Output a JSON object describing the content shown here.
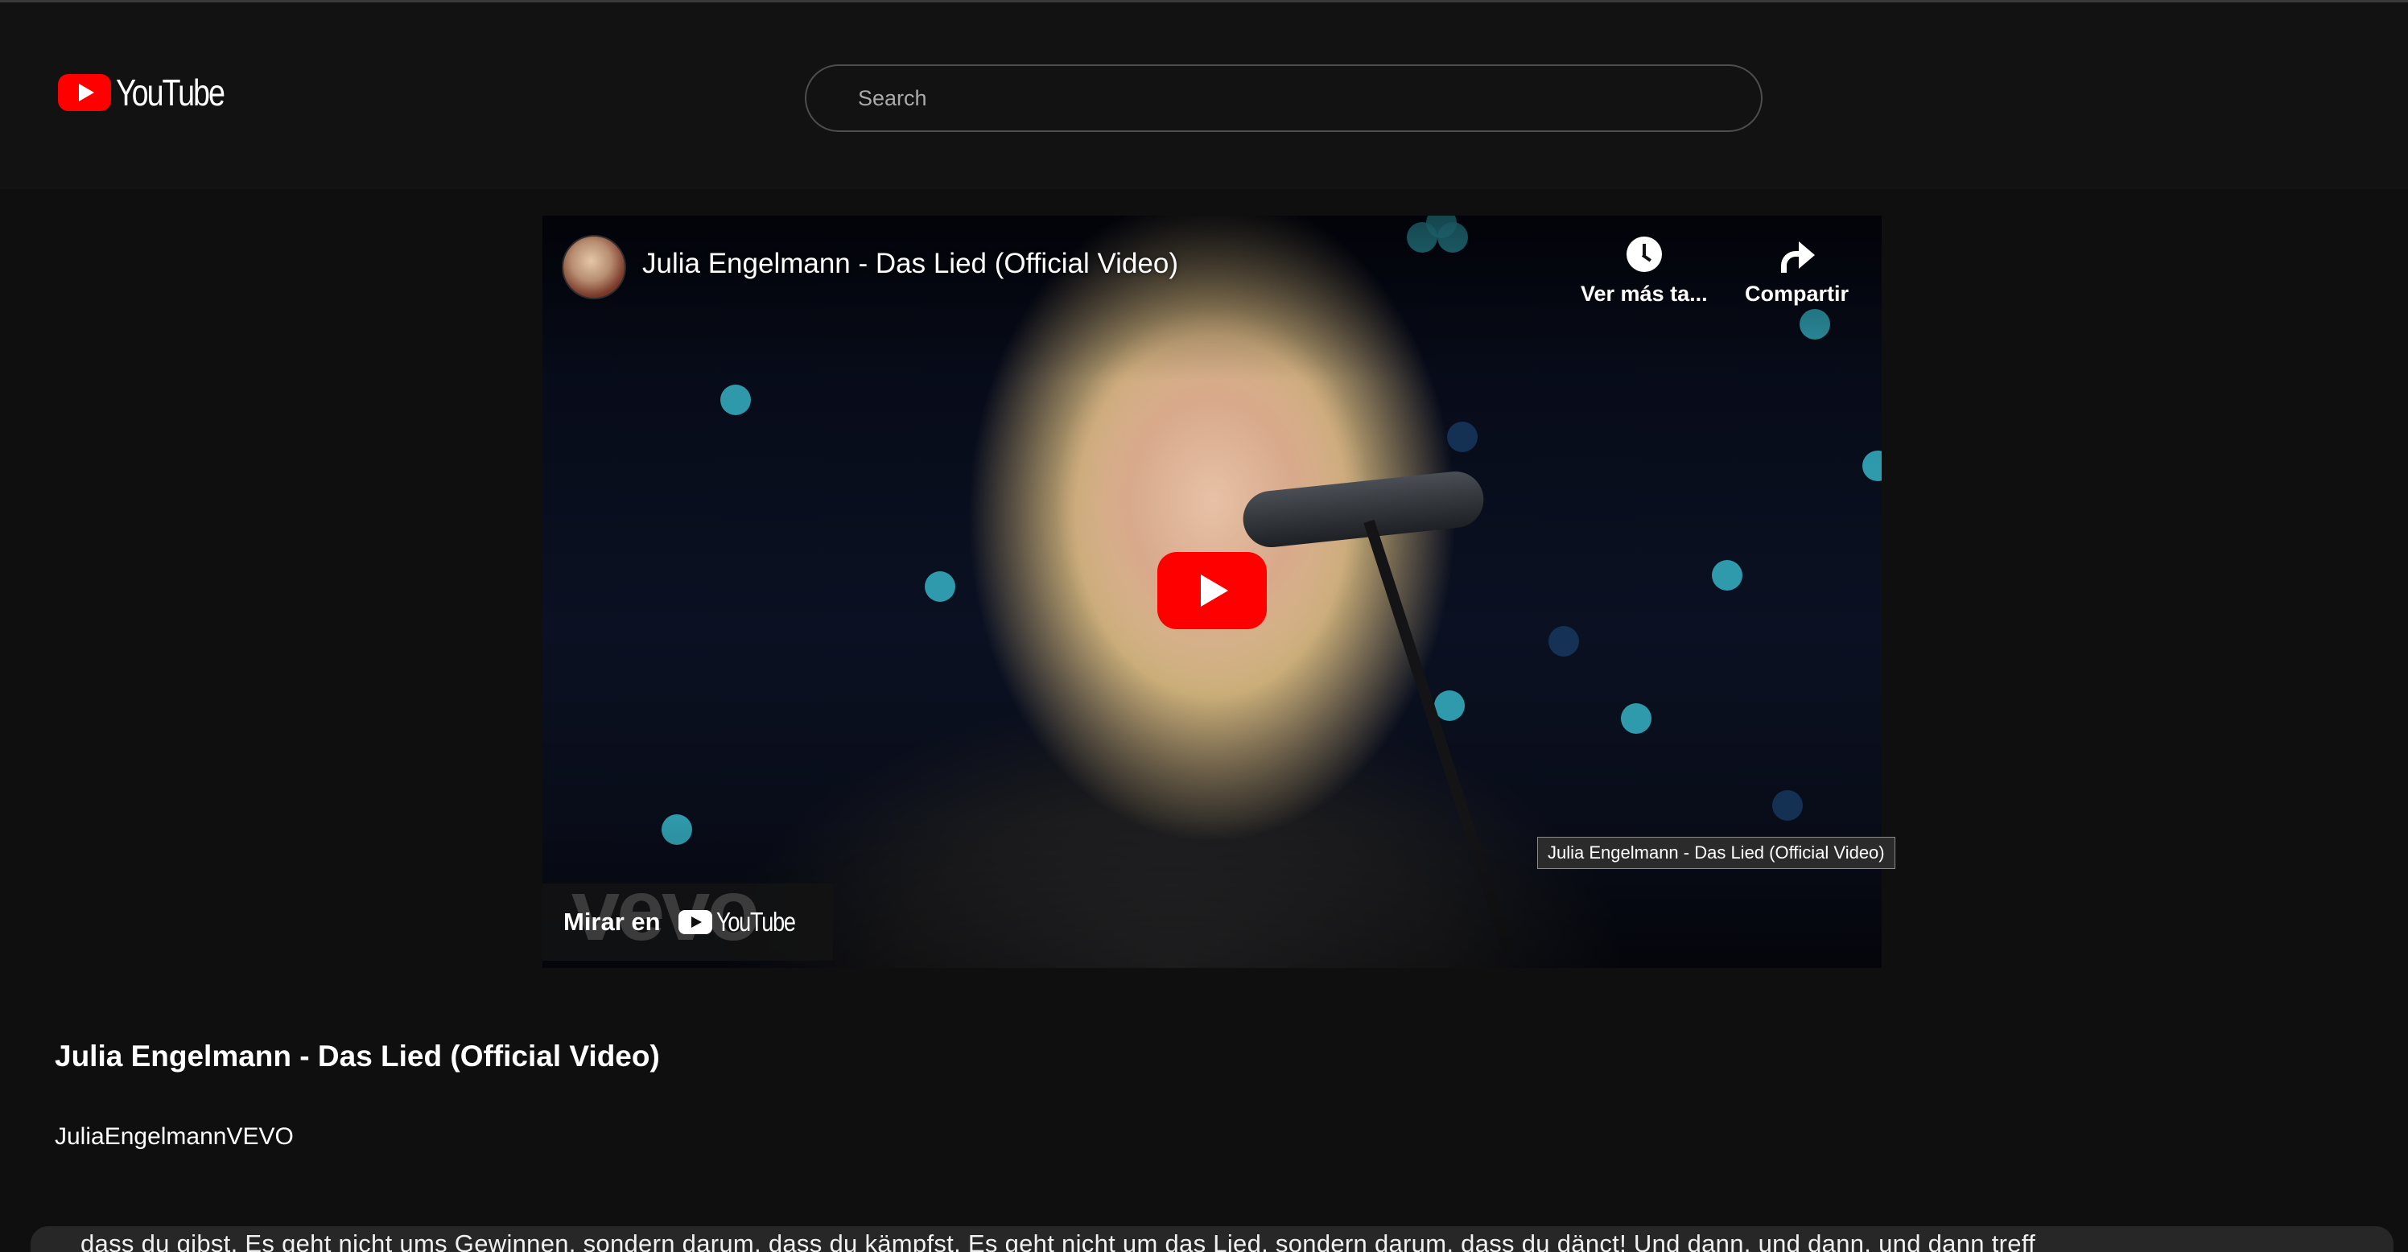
{
  "header": {
    "logo_text": "YouTube",
    "search_placeholder": "Search"
  },
  "player": {
    "title": "Julia Engelmann - Das Lied (Official Video)",
    "watch_later_label": "Ver más ta...",
    "share_label": "Compartir",
    "watch_on_label": "Mirar en",
    "watch_on_brand": "YouTube",
    "vevo_watermark": "vevo",
    "tooltip": "Julia Engelmann - Das Lied (Official Video)"
  },
  "video": {
    "title": "Julia Engelmann - Das Lied (Official Video)",
    "channel": "JuliaEngelmannVEVO"
  },
  "lyrics": {
    "text": "dass du gibst. Es geht nicht ums Gewinnen, sondern darum, dass du kämpfst. Es geht nicht um das Lied, sondern darum, dass du dänct! Und dann, und dann, und dann treff"
  },
  "colors": {
    "background": "#0f0f0f",
    "header": "#121212",
    "brand_red": "#ff0000",
    "lyrics_bar": "#272727"
  }
}
